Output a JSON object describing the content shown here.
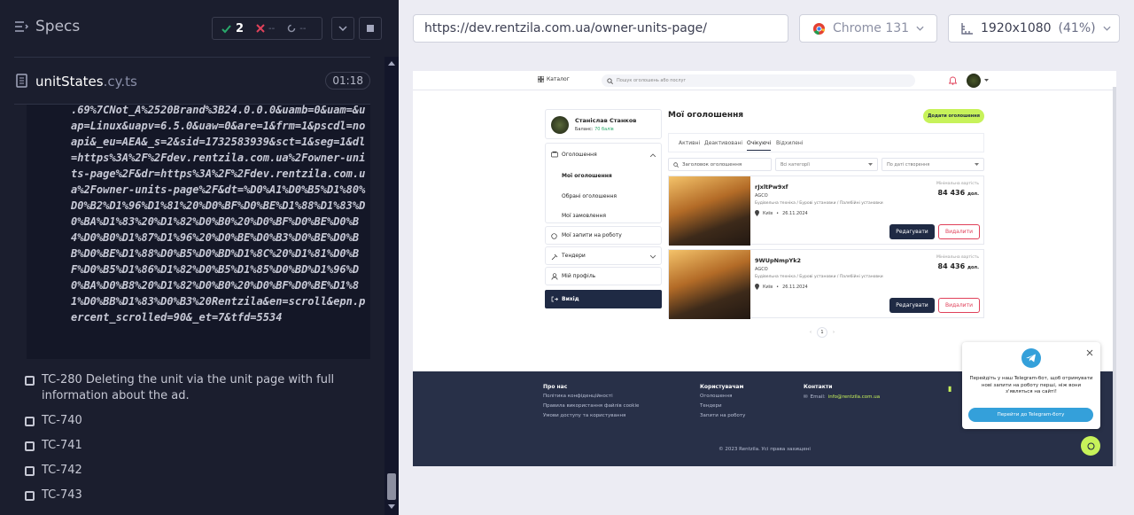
{
  "specs": {
    "title": "Specs",
    "passed": "2",
    "failed": "--",
    "pending": "--"
  },
  "file": {
    "name": "unitStates",
    "ext": ".cy.ts",
    "timer": "01:18"
  },
  "log_text": ".69%7CNot_A%2520Brand%3B24.0.0.0&uamb=0&uam=&uap=Linux&uapv=6.5.0&uaw=0&are=1&frm=1&pscdl=noapi&_eu=AEA&_s=2&sid=1732583939&sct=1&seg=1&dl=https%3A%2F%2Fdev.rentzila.com.ua%2Fowner-units-page%2F&dr=https%3A%2F%2Fdev.rentzila.com.ua%2Fowner-units-page%2F&dt=%D0%A1%D0%B5%D1%80%D0%B2%D1%96%D1%81%20%D0%BF%D0%BE%D1%88%D1%83%D0%BA%D1%83%20%D1%82%D0%B0%20%D0%BF%D0%BE%D0%B4%D0%B0%D1%87%D1%96%20%D0%BE%D0%B3%D0%BE%D0%BB%D0%BE%D1%88%D0%B5%D0%BD%D1%8C%20%D1%81%D0%BF%D0%B5%D1%86%D1%82%D0%B5%D1%85%D0%BD%D1%96%D0%BA%D0%B8%20%D1%82%D0%B0%20%D0%BF%D0%BE%D1%81%D0%BB%D1%83%D0%B3%20Rentzila&en=scroll&epn.percent_scrolled=90&_et=7&tfd=5534",
  "tests": [
    {
      "label": "TC-280 Deleting the unit via the unit page with full information about the ad."
    },
    {
      "label": "TC-740"
    },
    {
      "label": "TC-741"
    },
    {
      "label": "TC-742"
    },
    {
      "label": "TC-743"
    }
  ],
  "browser": {
    "url": "https://dev.rentzila.com.ua/owner-units-page/",
    "name": "Chrome 131",
    "viewport": "1920x1080",
    "zoom": "(41%)"
  },
  "app": {
    "nav": {
      "catalog": "Каталог",
      "search_placeholder": "Пошук оголошень або послуг"
    },
    "user": {
      "name": "Станіслав Станков",
      "balance_label": "Баланс:",
      "balance": "70 балів"
    },
    "menu": {
      "ads": "Оголошення",
      "my_ads": "Мої оголошення",
      "fav_ads": "Обрані оголошення",
      "my_orders": "Мої замовлення",
      "my_requests": "Мої запити на роботу",
      "tenders": "Тендери",
      "profile": "Мій профіль",
      "logout": "Вихід"
    },
    "page_title": "Мої оголошення",
    "add_button": "Додати оголошення",
    "tabs": [
      "Активні",
      "Деактивовані",
      "Очікуючі",
      "Відхилені"
    ],
    "filter_search": "Заголовок оголошення",
    "filter_category": "Всі категорії",
    "filter_sort": "По даті створення",
    "units": [
      {
        "title": "rJxltPw9xf",
        "brand": "AGCO",
        "category": "Будівельна техніка / Бурові установки / Палебійні установки",
        "city": "Київ",
        "date": "26.11.2024",
        "price_label": "Мінімальна вартість",
        "price": "84 436",
        "currency": "дол.",
        "edit": "Редагувати",
        "delete": "Видалити"
      },
      {
        "title": "9WUpNmpYk2",
        "brand": "AGCO",
        "category": "Будівельна техніка / Бурові установки / Палебійні установки",
        "city": "Київ",
        "date": "26.11.2024",
        "price_label": "Мінімальна вартість",
        "price": "84 436",
        "currency": "дол.",
        "edit": "Редагувати",
        "delete": "Видалити"
      }
    ],
    "page_number": "1",
    "footer": {
      "about": "Про нас",
      "privacy": "Політика конфіденційності",
      "cookies": "Правила використання файлів cookie",
      "terms": "Умови доступу та користування",
      "users": "Користувачам",
      "ads": "Оголошення",
      "tenders": "Тендери",
      "requests": "Запити на роботу",
      "contacts": "Контакти",
      "email_label": "Email:",
      "email": "info@rentzila.com.ua",
      "copyright": "© 2023 Rentzila. Усі права захищені"
    },
    "popup": {
      "text": "Перейдіть у наш Telegram-бот, щоб отримувати нові запити на роботу перші, ніж вони з'являться на сайті!",
      "button": "Перейти до Telegram-боту"
    }
  },
  "colors": {
    "accent_green": "#c7f25a",
    "dark_navy": "#1f2a44",
    "delete_red": "#e0415a"
  }
}
